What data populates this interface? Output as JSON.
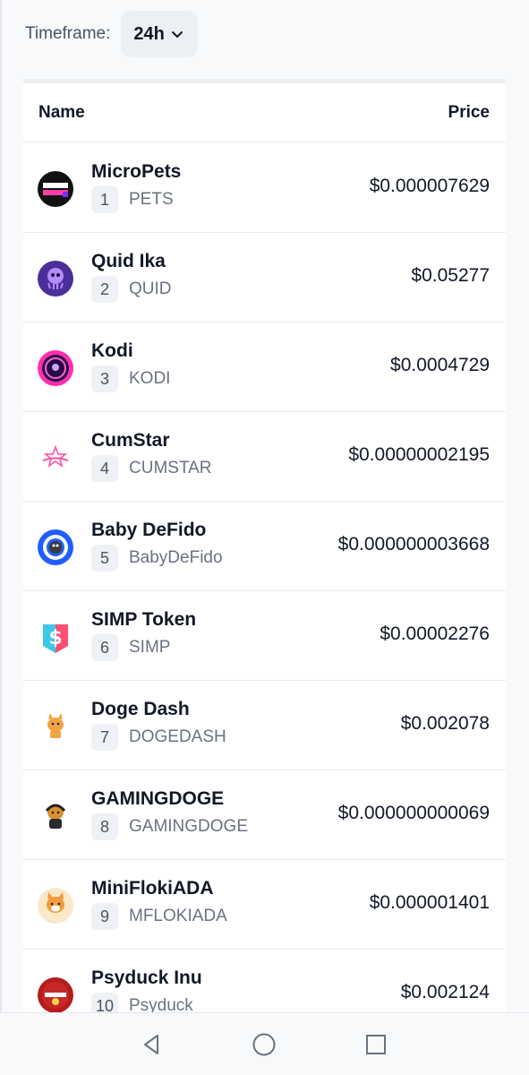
{
  "timeframe": {
    "label": "Timeframe:",
    "selected": "24h"
  },
  "table": {
    "headers": {
      "name": "Name",
      "price": "Price"
    },
    "rows": [
      {
        "rank": "1",
        "name": "MicroPets",
        "symbol": "PETS",
        "price": "$0.000007629",
        "logo_icon": "micropets-logo-icon"
      },
      {
        "rank": "2",
        "name": "Quid Ika",
        "symbol": "QUID",
        "price": "$0.05277",
        "logo_icon": "quid-ika-logo-icon"
      },
      {
        "rank": "3",
        "name": "Kodi",
        "symbol": "KODI",
        "price": "$0.0004729",
        "logo_icon": "kodi-logo-icon"
      },
      {
        "rank": "4",
        "name": "CumStar",
        "symbol": "CUMSTAR",
        "price": "$0.00000002195",
        "logo_icon": "cumstar-logo-icon"
      },
      {
        "rank": "5",
        "name": "Baby DeFido",
        "symbol": "BabyDeFido",
        "price": "$0.000000003668",
        "logo_icon": "baby-defido-logo-icon"
      },
      {
        "rank": "6",
        "name": "SIMP Token",
        "symbol": "SIMP",
        "price": "$0.00002276",
        "logo_icon": "simp-token-logo-icon"
      },
      {
        "rank": "7",
        "name": "Doge Dash",
        "symbol": "DOGEDASH",
        "price": "$0.002078",
        "logo_icon": "doge-dash-logo-icon"
      },
      {
        "rank": "8",
        "name": "GAMINGDOGE",
        "symbol": "GAMINGDOGE",
        "price": "$0.000000000069",
        "logo_icon": "gamingdoge-logo-icon"
      },
      {
        "rank": "9",
        "name": "MiniFlokiADA",
        "symbol": "MFLOKIADA",
        "price": "$0.000001401",
        "logo_icon": "minifloki-ada-logo-icon"
      },
      {
        "rank": "10",
        "name": "Psyduck Inu",
        "symbol": "Psyduck",
        "price": "$0.002124",
        "logo_icon": "psyduck-inu-logo-icon"
      }
    ]
  },
  "nav": {
    "back_icon": "back-triangle-icon",
    "home_icon": "home-circle-icon",
    "recents_icon": "recents-square-icon"
  },
  "colors": {
    "background": "#f8f9fb",
    "card": "#ffffff",
    "badge": "#eef1f5",
    "text_primary": "#111827",
    "text_secondary": "#6b7280"
  }
}
